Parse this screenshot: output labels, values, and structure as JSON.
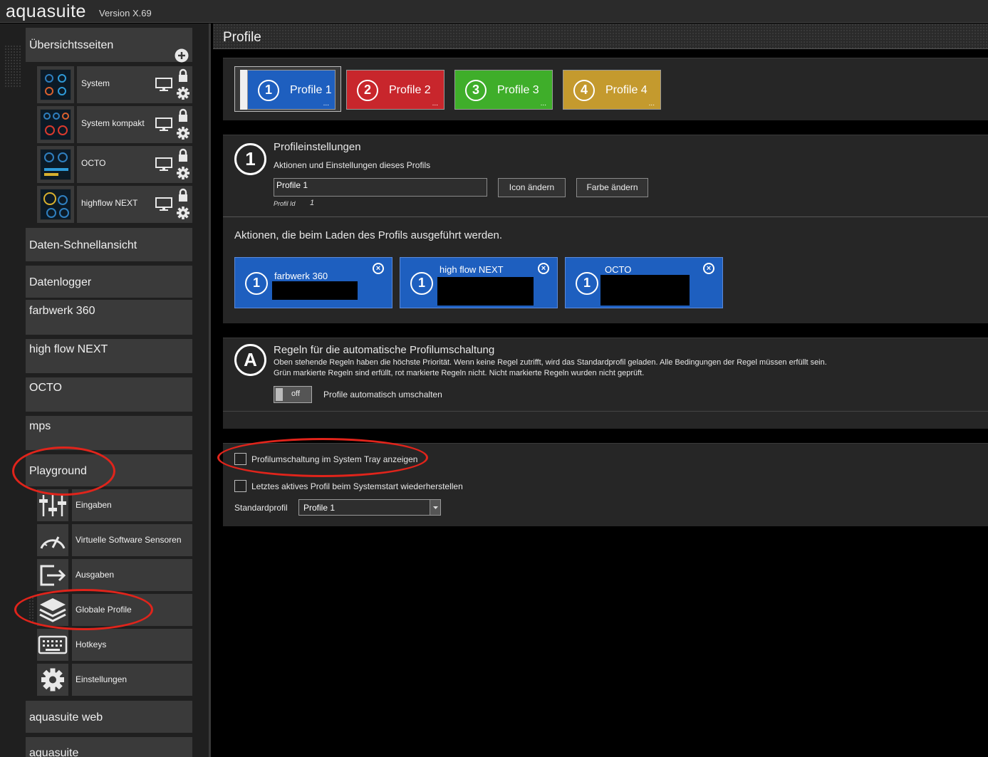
{
  "app": {
    "title": "aquasuite",
    "version": "Version X.69"
  },
  "sidebar": {
    "overview_label": "Übersichtsseiten",
    "add_icon": "plus-circle-icon",
    "overview_pages": [
      {
        "label": "System"
      },
      {
        "label": "System kompakt"
      },
      {
        "label": "OCTO"
      },
      {
        "label": "highflow NEXT"
      }
    ],
    "items": [
      {
        "label": "Daten-Schnellansicht"
      },
      {
        "label": "Datenlogger"
      },
      {
        "label": "farbwerk 360"
      },
      {
        "label": "high flow NEXT"
      },
      {
        "label": "OCTO"
      },
      {
        "label": "mps"
      },
      {
        "label": "Playground"
      }
    ],
    "playground_items": [
      {
        "label": "Eingaben",
        "icon": "sliders-icon"
      },
      {
        "label": "Virtuelle Software Sensoren",
        "icon": "gauge-icon"
      },
      {
        "label": "Ausgaben",
        "icon": "export-icon"
      },
      {
        "label": "Globale Profile",
        "icon": "layers-icon"
      },
      {
        "label": "Hotkeys",
        "icon": "keyboard-icon"
      },
      {
        "label": "Einstellungen",
        "icon": "gear-icon"
      }
    ],
    "bottom_items": [
      {
        "label": "aquasuite web"
      },
      {
        "label": "aquasuite"
      }
    ]
  },
  "main": {
    "title": "Profile",
    "profiles": [
      {
        "num": "1",
        "label": "Profile 1",
        "color": "#1e5fbf",
        "more": "..."
      },
      {
        "num": "2",
        "label": "Profile 2",
        "color": "#c8262c",
        "more": "..."
      },
      {
        "num": "3",
        "label": "Profile 3",
        "color": "#3fae2a",
        "more": "..."
      },
      {
        "num": "4",
        "label": "Profile 4",
        "color": "#c49a2e",
        "more": "..."
      }
    ],
    "settings": {
      "icon_num": "1",
      "title": "Profileinstellungen",
      "subtitle": "Aktionen und Einstellungen dieses Profils",
      "name_value": "Profile 1",
      "icon_button": "Icon ändern",
      "color_button": "Farbe ändern",
      "id_label": "Profil Id",
      "id_value": "1"
    },
    "actions": {
      "heading": "Aktionen, die beim Laden des Profils ausgeführt werden.",
      "cards": [
        {
          "num": "1",
          "name": "farbwerk 360",
          "close": "×"
        },
        {
          "num": "1",
          "name": "high flow NEXT",
          "close": "×"
        },
        {
          "num": "1",
          "name": "OCTO",
          "close": "×"
        }
      ]
    },
    "rules": {
      "icon_letter": "A",
      "title": "Regeln für die automatische Profilumschaltung",
      "line1": "Oben stehende Regeln haben die höchste Priorität. Wenn keine Regel zutrifft, wird das Standardprofil geladen. Alle Bedingungen der Regel müssen erfüllt sein.",
      "line2": "Grün markierte Regeln sind erfüllt, rot markierte Regeln nicht. Nicht markierte Regeln wurden nicht geprüft.",
      "toggle_text": "off",
      "toggle_label": "Profile automatisch umschalten"
    },
    "options": {
      "tray_label": "Profilumschaltung im System Tray anzeigen",
      "restore_label": "Letztes aktives Profil beim Systemstart wiederherstellen",
      "default_label": "Standardprofil",
      "default_value": "Profile 1"
    }
  }
}
